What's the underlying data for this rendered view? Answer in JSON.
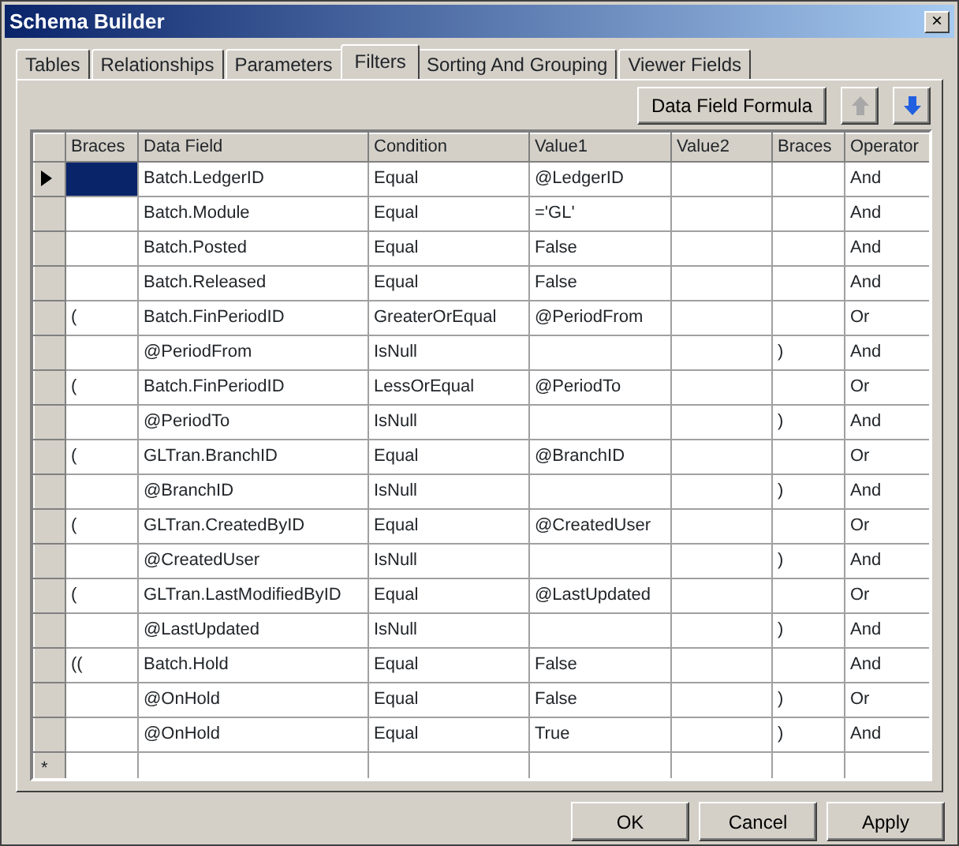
{
  "window": {
    "title": "Schema Builder",
    "close": "×"
  },
  "tabs": [
    {
      "label": "Tables",
      "selected": false
    },
    {
      "label": "Relationships",
      "selected": false
    },
    {
      "label": "Parameters",
      "selected": false
    },
    {
      "label": "Filters",
      "selected": true
    },
    {
      "label": "Sorting And Grouping",
      "selected": false
    },
    {
      "label": "Viewer Fields",
      "selected": false
    }
  ],
  "toolbar": {
    "formula_button": "Data Field Formula"
  },
  "table": {
    "columns": [
      "Braces",
      "Data Field",
      "Condition",
      "Value1",
      "Value2",
      "Braces",
      "Operator"
    ],
    "rows": [
      {
        "current": true,
        "cells": [
          "",
          "Batch.LedgerID",
          "Equal",
          "@LedgerID",
          "",
          "",
          "And"
        ]
      },
      {
        "current": false,
        "cells": [
          "",
          "Batch.Module",
          "Equal",
          "='GL'",
          "",
          "",
          "And"
        ]
      },
      {
        "current": false,
        "cells": [
          "",
          "Batch.Posted",
          "Equal",
          "False",
          "",
          "",
          "And"
        ]
      },
      {
        "current": false,
        "cells": [
          "",
          "Batch.Released",
          "Equal",
          "False",
          "",
          "",
          "And"
        ]
      },
      {
        "current": false,
        "cells": [
          "(",
          "Batch.FinPeriodID",
          "GreaterOrEqual",
          "@PeriodFrom",
          "",
          "",
          "Or"
        ]
      },
      {
        "current": false,
        "cells": [
          "",
          "@PeriodFrom",
          "IsNull",
          "",
          "",
          ")",
          "And"
        ]
      },
      {
        "current": false,
        "cells": [
          "(",
          "Batch.FinPeriodID",
          "LessOrEqual",
          "@PeriodTo",
          "",
          "",
          "Or"
        ]
      },
      {
        "current": false,
        "cells": [
          "",
          "@PeriodTo",
          "IsNull",
          "",
          "",
          ")",
          "And"
        ]
      },
      {
        "current": false,
        "cells": [
          "(",
          "GLTran.BranchID",
          "Equal",
          "@BranchID",
          "",
          "",
          "Or"
        ]
      },
      {
        "current": false,
        "cells": [
          "",
          "@BranchID",
          "IsNull",
          "",
          "",
          ")",
          "And"
        ]
      },
      {
        "current": false,
        "cells": [
          "(",
          "GLTran.CreatedByID",
          "Equal",
          "@CreatedUser",
          "",
          "",
          "Or"
        ]
      },
      {
        "current": false,
        "cells": [
          "",
          "@CreatedUser",
          "IsNull",
          "",
          "",
          ")",
          "And"
        ]
      },
      {
        "current": false,
        "cells": [
          "(",
          "GLTran.LastModifiedByID",
          "Equal",
          "@LastUpdated",
          "",
          "",
          "Or"
        ]
      },
      {
        "current": false,
        "cells": [
          "",
          "@LastUpdated",
          "IsNull",
          "",
          "",
          ")",
          "And"
        ]
      },
      {
        "current": false,
        "cells": [
          "((",
          "Batch.Hold",
          "Equal",
          "False",
          "",
          "",
          "And"
        ]
      },
      {
        "current": false,
        "cells": [
          "",
          "@OnHold",
          "Equal",
          "False",
          "",
          ")",
          "Or"
        ]
      },
      {
        "current": false,
        "cells": [
          "",
          "@OnHold",
          "Equal",
          "True",
          "",
          ")",
          "And"
        ]
      }
    ],
    "new_row_marker": "*"
  },
  "buttons": [
    "OK",
    "Cancel",
    "Apply"
  ]
}
